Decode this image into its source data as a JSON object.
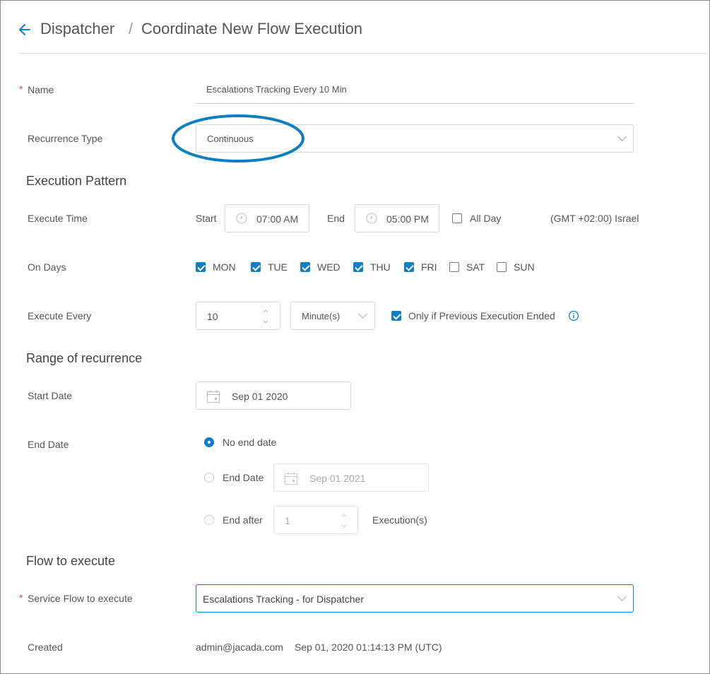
{
  "header": {
    "parent": "Dispatcher",
    "separator": "/",
    "title": "Coordinate New Flow Execution"
  },
  "form": {
    "required_mark": "*",
    "name": {
      "label": "Name",
      "value": "Escalations Tracking Every 10 Min"
    },
    "recurrence_type": {
      "label": "Recurrence Type",
      "value": "Continuous"
    },
    "execution_pattern": {
      "heading": "Execution Pattern",
      "execute_time": {
        "label": "Execute Time",
        "start_label": "Start",
        "start_value": "07:00 AM",
        "end_label": "End",
        "end_value": "05:00 PM",
        "all_day_label": "All Day",
        "all_day_checked": false,
        "timezone": "(GMT +02:00) Israel"
      },
      "on_days": {
        "label": "On Days",
        "days": [
          {
            "label": "MON",
            "checked": true
          },
          {
            "label": "TUE",
            "checked": true
          },
          {
            "label": "WED",
            "checked": true
          },
          {
            "label": "THU",
            "checked": true
          },
          {
            "label": "FRI",
            "checked": true
          },
          {
            "label": "SAT",
            "checked": false
          },
          {
            "label": "SUN",
            "checked": false
          }
        ]
      },
      "execute_every": {
        "label": "Execute Every",
        "value": "10",
        "unit": "Minute(s)",
        "only_if_label": "Only if Previous Execution Ended",
        "only_if_checked": true
      }
    },
    "range": {
      "heading": "Range of recurrence",
      "start_date": {
        "label": "Start Date",
        "value": "Sep 01 2020"
      },
      "end_date": {
        "label": "End Date",
        "options": {
          "no_end": "No end date",
          "end_date": "End Date",
          "end_after": "End after"
        },
        "selected": "no_end",
        "end_date_value": "Sep 01 2021",
        "end_after_value": "1",
        "executions_label": "Execution(s)"
      }
    },
    "flow": {
      "heading": "Flow to execute",
      "service_flow": {
        "label": "Service Flow to execute",
        "value": "Escalations Tracking - for Dispatcher"
      },
      "created": {
        "label": "Created",
        "user": "admin@jacada.com",
        "timestamp": "Sep 01, 2020 01:14:13 PM (UTC)"
      }
    }
  },
  "colors": {
    "accent": "#0e7fc2",
    "required": "#d9534f",
    "highlight_ellipse": "#0e7fc2"
  }
}
